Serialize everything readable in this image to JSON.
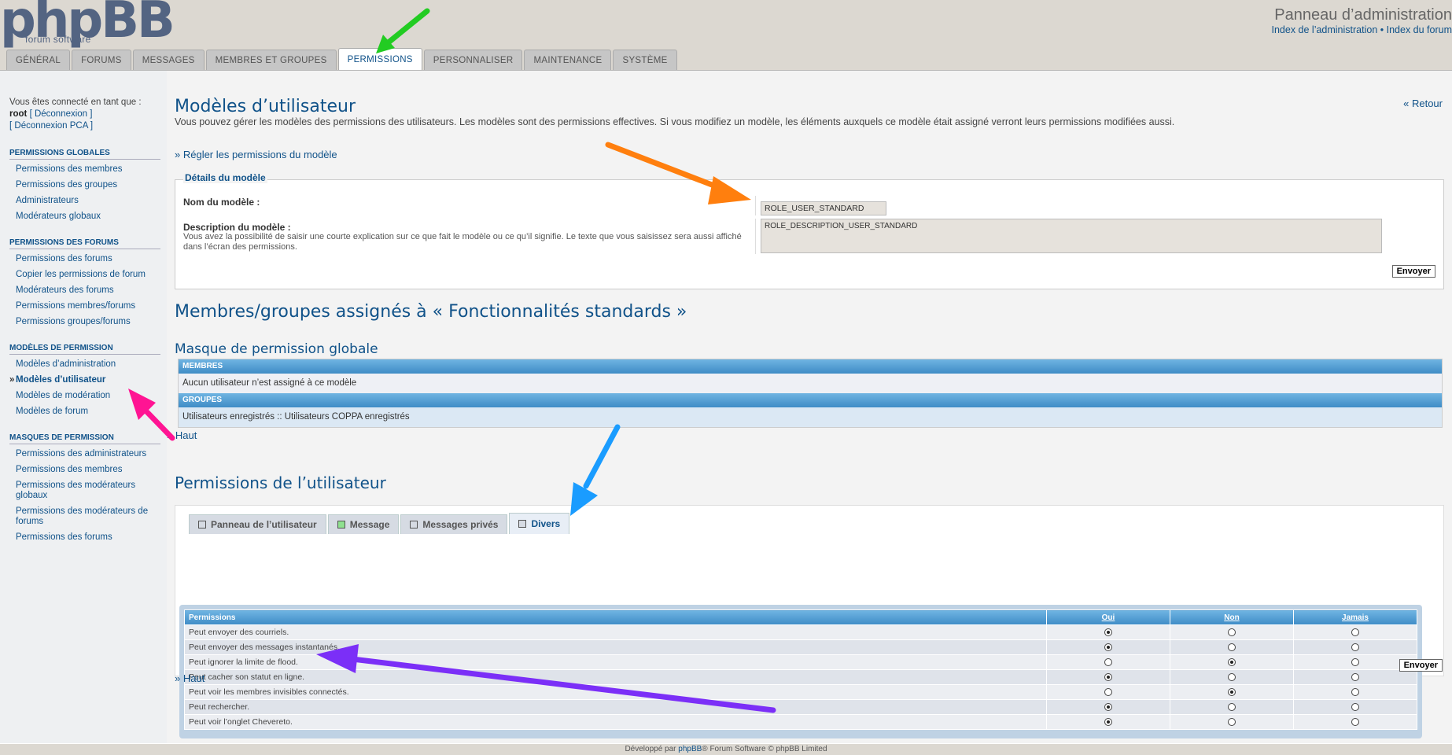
{
  "header": {
    "logo_text": "phpBB",
    "logo_sub": "forum  software",
    "title": "Panneau d’administration",
    "link_index_admin": "Index de l’administration",
    "separator": " • ",
    "link_index_forum": "Index du forum"
  },
  "tabs": [
    {
      "label": "Général"
    },
    {
      "label": "Forums"
    },
    {
      "label": "Messages"
    },
    {
      "label": "Membres et groupes"
    },
    {
      "label": "Permissions"
    },
    {
      "label": "Personnaliser"
    },
    {
      "label": "Maintenance"
    },
    {
      "label": "Système"
    }
  ],
  "sidebar": {
    "login_text": "Vous êtes connecté en tant que :",
    "user": "root",
    "logout": "[ Déconnexion ]",
    "logout_acp": "[ Déconnexion PCA ]",
    "sections": [
      {
        "title": "Permissions globales",
        "items": [
          "Permissions des membres",
          "Permissions des groupes",
          "Administrateurs",
          "Modérateurs globaux"
        ]
      },
      {
        "title": "Permissions des forums",
        "items": [
          "Permissions des forums",
          "Copier les permissions de forum",
          "Modérateurs des forums",
          "Permissions membres/forums",
          "Permissions groupes/forums"
        ]
      },
      {
        "title": "Modèles de permission",
        "items": [
          "Modèles d’administration",
          "Modèles d’utilisateur",
          "Modèles de modération",
          "Modèles de forum"
        ]
      },
      {
        "title": "Masques de permission",
        "items": [
          "Permissions des administrateurs",
          "Permissions des membres",
          "Permissions des modérateurs globaux",
          "Permissions des modérateurs de forums",
          "Permissions des forums"
        ]
      }
    ]
  },
  "main": {
    "title": "Modèles d’utilisateur",
    "back": "« Retour",
    "description": "Vous pouvez gérer les modèles des permissions des utilisateurs. Les modèles sont des permissions effectives. Si vous modifiez un modèle, les éléments auxquels ce modèle était assigné verront leurs permissions modifiées aussi.",
    "set_link": "» Régler les permissions du modèle",
    "details_legend": "Détails du modèle",
    "name_label": "Nom du modèle :",
    "name_value": "ROLE_USER_STANDARD",
    "desc_label": "Description du modèle :",
    "desc_note": "Vous avez la possibilité de saisir une courte explication sur ce que fait le modèle ou ce qu’il signifie. Le texte que vous saisissez sera aussi affiché dans l’écran des permissions.",
    "desc_value": "ROLE_DESCRIPTION_USER_STANDARD",
    "submit": "Envoyer",
    "assigned_title": "Membres/groupes assignés à « Fonctionnalités standards »",
    "mask_title": "Masque de permission globale",
    "members_head": "Membres",
    "members_value": "Aucun utilisateur n’est assigné à ce modèle",
    "groups_head": "Groupes",
    "groups_value": "Utilisateurs enregistrés :: Utilisateurs COPPA enregistrés",
    "top_link": "» Haut",
    "user_perm_title": "Permissions de l’utilisateur",
    "perm_tabs": [
      {
        "label": "Panneau de l’utilisateur",
        "color": "#d6dbe3"
      },
      {
        "label": "Message",
        "color": "#8fe08f"
      },
      {
        "label": "Messages privés",
        "color": "#d6dbe3"
      },
      {
        "label": "Divers",
        "color": "#d6dbe3"
      }
    ],
    "perm_headers": {
      "permissions": "Permissions",
      "yes": "Oui",
      "no": "Non",
      "never": "Jamais"
    },
    "perm_rows": [
      {
        "label": "Peut envoyer des courriels.",
        "value": "yes"
      },
      {
        "label": "Peut envoyer des messages instantanés.",
        "value": "yes"
      },
      {
        "label": "Peut ignorer la limite de flood.",
        "value": "no"
      },
      {
        "label": "Peut cacher son statut en ligne.",
        "value": "yes"
      },
      {
        "label": "Peut voir les membres invisibles connectés.",
        "value": "no"
      },
      {
        "label": "Peut rechercher.",
        "value": "yes"
      },
      {
        "label": "Peut voir l’onglet Chevereto.",
        "value": "yes"
      }
    ],
    "submit2": "Envoyer",
    "top_link2": "» Haut"
  },
  "footer": {
    "prefix": "Développé par ",
    "link": "phpBB",
    "suffix": "® Forum Software © phpBB Limited"
  },
  "annotation_colors": {
    "green": "#22cc22",
    "orange": "#ff7f0e",
    "pink": "#ff1493",
    "blue": "#1a9cff",
    "purple": "#7b2ff7"
  }
}
